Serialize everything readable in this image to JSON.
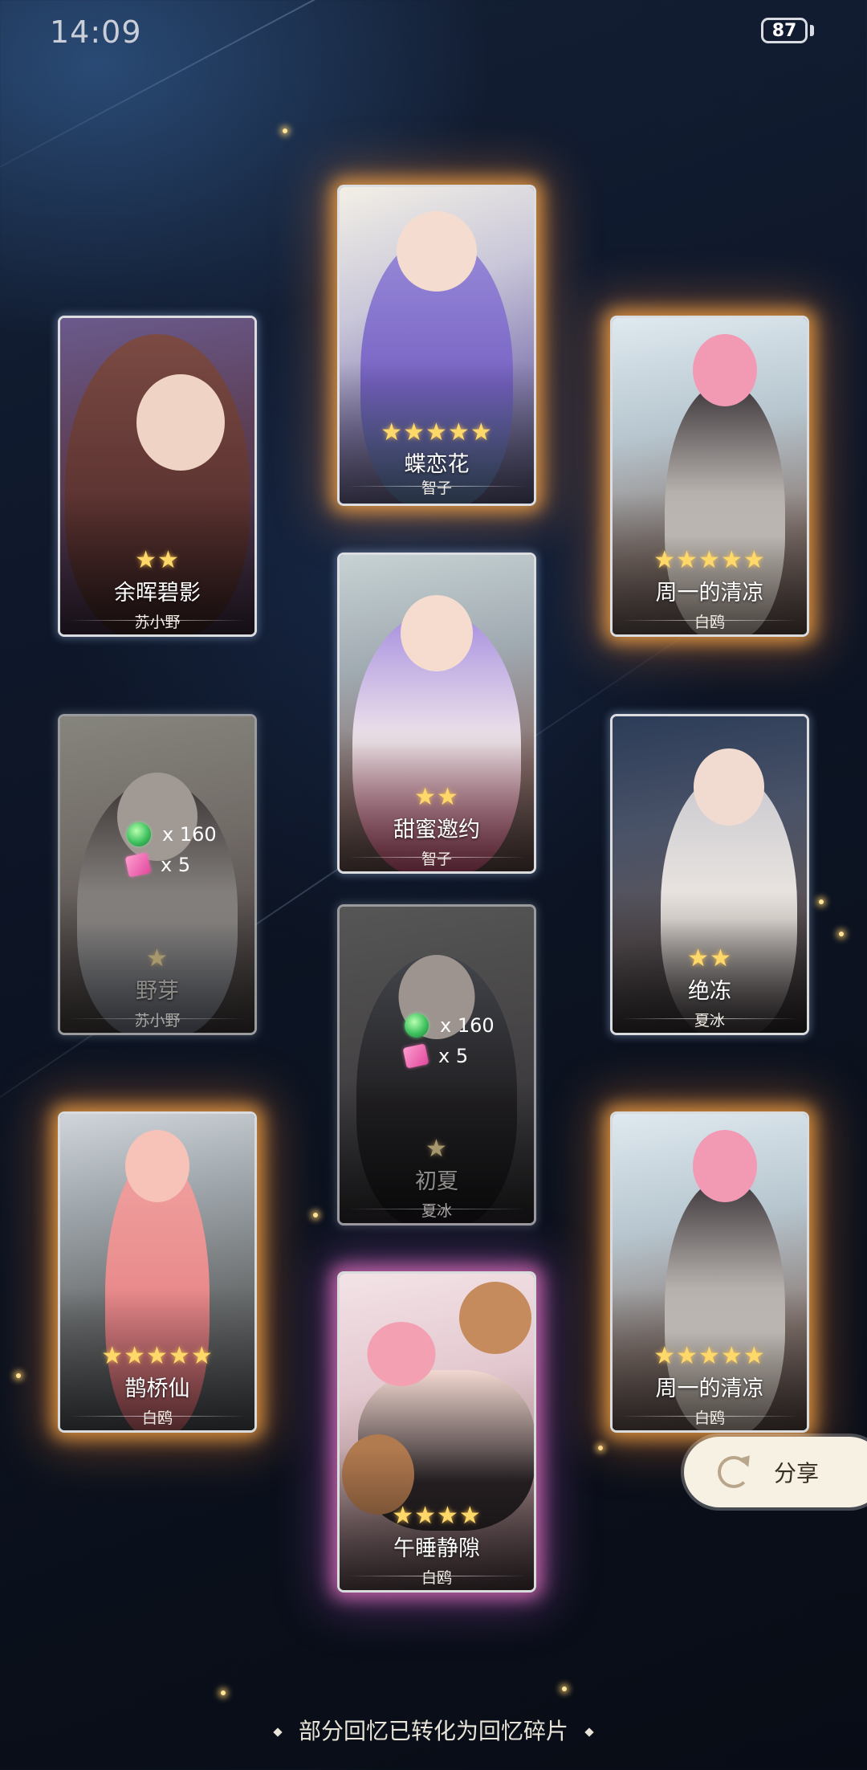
{
  "status": {
    "time": "14:09",
    "battery": "87"
  },
  "cards": [
    {
      "id": "c1",
      "title": "蝶恋花",
      "author": "智子",
      "stars": "★★★★★",
      "converted": false
    },
    {
      "id": "c2",
      "title": "余晖碧影",
      "author": "苏小野",
      "stars": "★★",
      "converted": false
    },
    {
      "id": "c3",
      "title": "周一的清凉",
      "author": "白鸥",
      "stars": "★★★★★",
      "converted": false
    },
    {
      "id": "c4",
      "title": "甜蜜邀约",
      "author": "智子",
      "stars": "★★",
      "converted": false
    },
    {
      "id": "c5",
      "title": "野芽",
      "author": "苏小野",
      "stars": "★",
      "converted": true,
      "reward_gem": "x 160",
      "reward_piece": "x 5"
    },
    {
      "id": "c6",
      "title": "绝冻",
      "author": "夏冰",
      "stars": "★★",
      "converted": false
    },
    {
      "id": "c7",
      "title": "初夏",
      "author": "夏冰",
      "stars": "★",
      "converted": true,
      "reward_gem": "x 160",
      "reward_piece": "x 5"
    },
    {
      "id": "c8",
      "title": "鹊桥仙",
      "author": "白鸥",
      "stars": "★★★★★",
      "converted": false
    },
    {
      "id": "c9",
      "title": "周一的清凉",
      "author": "白鸥",
      "stars": "★★★★★",
      "converted": false
    },
    {
      "id": "c10",
      "title": "午睡静隙",
      "author": "白鸥",
      "stars": "★★★★",
      "converted": false
    }
  ],
  "share": {
    "label": "分享"
  },
  "footer": {
    "text": "部分回忆已转化为回忆碎片"
  },
  "colors": {
    "gold_glow": "#ffaa46",
    "pink_glow": "#f078c8",
    "star": "#ffd86a",
    "share_bg": "#f6f1e3"
  }
}
